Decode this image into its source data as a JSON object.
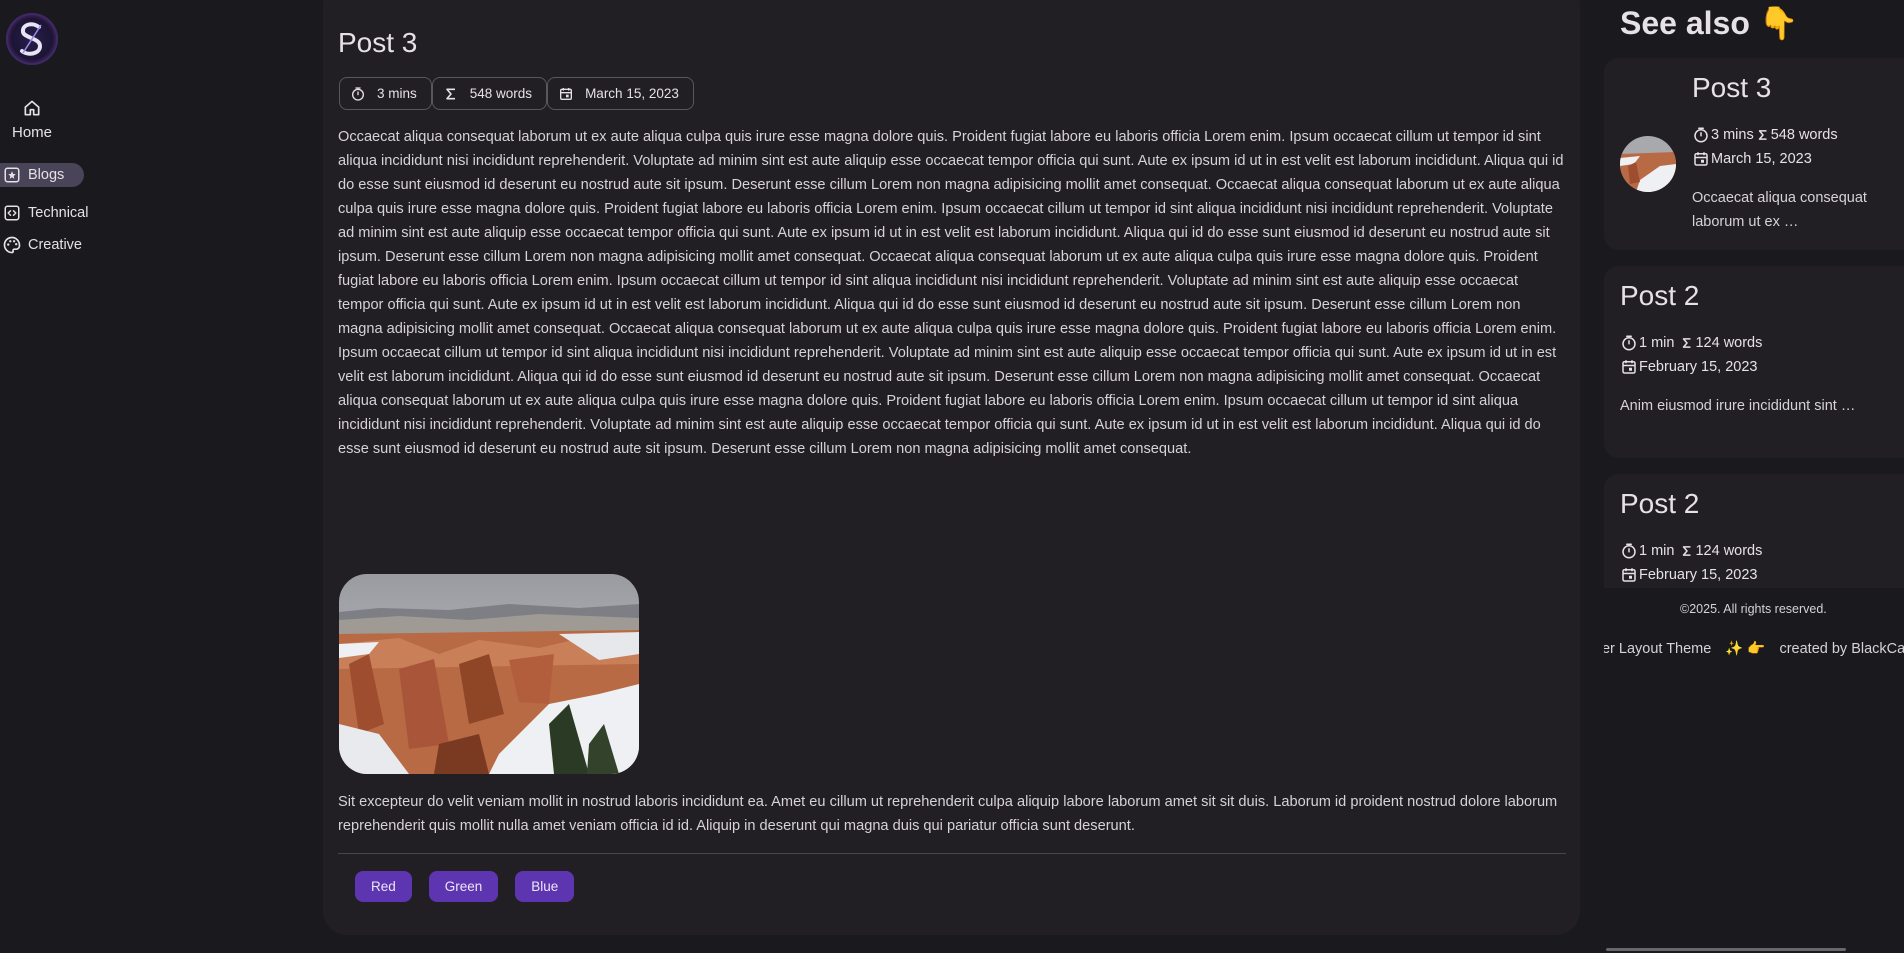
{
  "nav": {
    "logo_icon": "s-monogram-logo",
    "home_label": "Home",
    "items": [
      {
        "label": "Blogs",
        "icon": "star-box-icon",
        "active": true
      },
      {
        "label": "Technical",
        "icon": "code-box-icon",
        "active": false
      },
      {
        "label": "Creative",
        "icon": "palette-icon",
        "active": false
      }
    ]
  },
  "post": {
    "title": "Post 3",
    "meta": {
      "read_time": "3 mins",
      "word_count": "548 words",
      "date": "March 15, 2023"
    },
    "paragraph1": "Occaecat aliqua consequat laborum ut ex aute aliqua culpa quis irure esse magna dolore quis. Proident fugiat labore eu laboris officia Lorem enim. Ipsum occaecat cillum ut tempor id sint aliqua incididunt nisi incididunt reprehenderit. Voluptate ad minim sint est aute aliquip esse occaecat tempor officia qui sunt. Aute ex ipsum id ut in est velit est laborum incididunt. Aliqua qui id do esse sunt eiusmod id deserunt eu nostrud aute sit ipsum. Deserunt esse cillum Lorem non magna adipisicing mollit amet consequat. Occaecat aliqua consequat laborum ut ex aute aliqua culpa quis irure esse magna dolore quis. Proident fugiat labore eu laboris officia Lorem enim. Ipsum occaecat cillum ut tempor id sint aliqua incididunt nisi incididunt reprehenderit. Voluptate ad minim sint est aute aliquip esse occaecat tempor officia qui sunt. Aute ex ipsum id ut in est velit est laborum incididunt. Aliqua qui id do esse sunt eiusmod id deserunt eu nostrud aute sit ipsum. Deserunt esse cillum Lorem non magna adipisicing mollit amet consequat. Occaecat aliqua consequat laborum ut ex aute aliqua culpa quis irure esse magna dolore quis. Proident fugiat labore eu laboris officia Lorem enim. Ipsum occaecat cillum ut tempor id sint aliqua incididunt nisi incididunt reprehenderit. Voluptate ad minim sint est aute aliquip esse occaecat tempor officia qui sunt. Aute ex ipsum id ut in est velit est laborum incididunt. Aliqua qui id do esse sunt eiusmod id deserunt eu nostrud aute sit ipsum. Deserunt esse cillum Lorem non magna adipisicing mollit amet consequat. Occaecat aliqua consequat laborum ut ex aute aliqua culpa quis irure esse magna dolore quis. Proident fugiat labore eu laboris officia Lorem enim. Ipsum occaecat cillum ut tempor id sint aliqua incididunt nisi incididunt reprehenderit. Voluptate ad minim sint est aute aliquip esse occaecat tempor officia qui sunt. Aute ex ipsum id ut in est velit est laborum incididunt. Aliqua qui id do esse sunt eiusmod id deserunt eu nostrud aute sit ipsum. Deserunt esse cillum Lorem non magna adipisicing mollit amet consequat. Occaecat aliqua consequat laborum ut ex aute aliqua culpa quis irure esse magna dolore quis. Proident fugiat labore eu laboris officia Lorem enim. Ipsum occaecat cillum ut tempor id sint aliqua incididunt nisi incididunt reprehenderit. Voluptate ad minim sint est aute aliquip esse occaecat tempor officia qui sunt. Aute ex ipsum id ut in est velit est laborum incididunt. Aliqua qui id do esse sunt eiusmod id deserunt eu nostrud aute sit ipsum. Deserunt esse cillum Lorem non magna adipisicing mollit amet consequat.",
    "image_alt": "snowy canyon landscape",
    "paragraph2": "Sit excepteur do velit veniam mollit in nostrud laboris incididunt ea. Amet eu cillum ut reprehenderit culpa aliquip labore laborum amet sit sit duis. Laborum id proident nostrud dolore laborum reprehenderit quis mollit nulla amet veniam officia id id. Aliquip in deserunt qui magna duis qui pariatur officia sunt deserunt.",
    "tags": [
      "Red",
      "Green",
      "Blue"
    ]
  },
  "see_also": {
    "heading": "See also 👇",
    "cards": [
      {
        "title": "Post 3",
        "read_time": "3 mins",
        "word_count": "548 words",
        "date": "March 15, 2023",
        "excerpt_line1": "Occaecat aliqua consequat",
        "excerpt_line2": "laborum ut ex …",
        "has_thumbnail": true
      },
      {
        "title": "Post 2",
        "read_time": "1 min",
        "word_count": "124 words",
        "date": "February 15, 2023",
        "excerpt_line1": "Anim eiusmod irure incididunt sint …",
        "has_thumbnail": false
      },
      {
        "title": "Post 2",
        "read_time": "1 min",
        "word_count": "124 words",
        "date": "February 15, 2023",
        "has_thumbnail": false
      }
    ]
  },
  "footer": {
    "copyright": "©2025. All rights reserved.",
    "theme_text": "Stargazer Layout Theme",
    "emoji": "✨ 👉",
    "credit_text": "created by BlackCat"
  },
  "colors": {
    "background": "#1a191d",
    "surface": "#211f23",
    "accent": "#5e35b1",
    "active_nav": "#4a4458"
  }
}
